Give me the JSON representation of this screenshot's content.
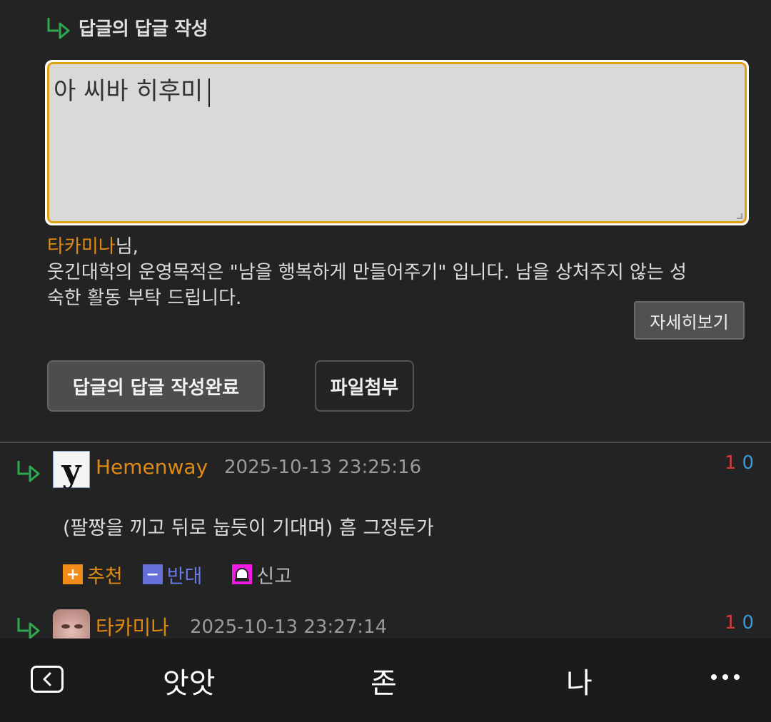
{
  "reply_form": {
    "title": "답글의 답글 작성",
    "textarea_value": "아 씨바 히후미",
    "notice_nick": "타카미나",
    "notice_suffix": "님,",
    "notice_line1": "웃긴대학의 운영목적은 \"남을 행복하게 만들어주기\" 입니다. 남을 상처주지 않는 성",
    "notice_line2": "숙한 활동 부탁 드립니다.",
    "detail_label": "자세히보기",
    "submit_label": "답글의 답글 작성완료",
    "attach_label": "파일첨부"
  },
  "comments": [
    {
      "nick": "Hemenway",
      "time": "2025-10-13 23:25:16",
      "up": "1",
      "down": "0",
      "body": "(팔짱을 끼고 뒤로 눕듯이 기대며) 흠 그정둔가",
      "avatar_letter": "y",
      "actions": {
        "recommend": "추천",
        "oppose": "반대",
        "report": "신고"
      }
    },
    {
      "nick": "타카미나",
      "time": "2025-10-13 23:27:14",
      "up": "1",
      "down": "0"
    }
  ],
  "bottom_nav": {
    "item1": "앗앗",
    "item2": "존",
    "item3": "나"
  },
  "colors": {
    "accent_orange": "#e08a12",
    "up_red": "#d83a3a",
    "down_blue": "#3a9ad8",
    "reply_arrow_green": "#2fa84f"
  }
}
